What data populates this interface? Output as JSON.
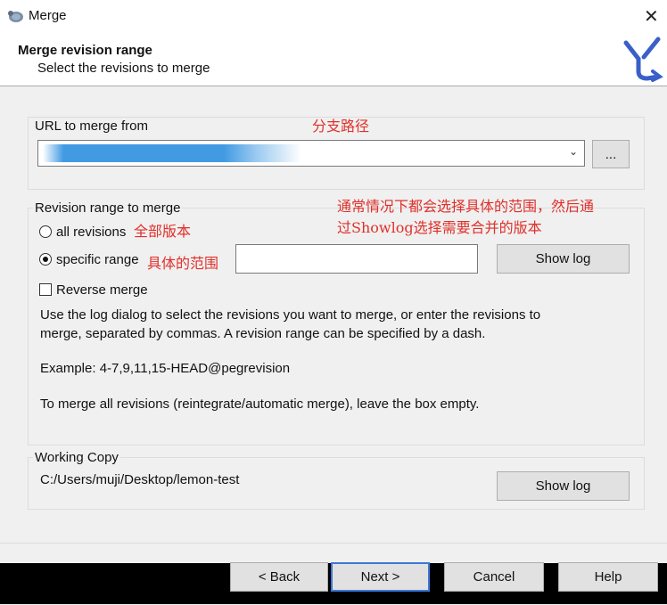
{
  "window": {
    "title": "Merge",
    "close_glyph": "✕"
  },
  "header": {
    "title": "Merge revision range",
    "subtitle": "Select the revisions to merge"
  },
  "url_group": {
    "label": "URL to merge from",
    "browse_label": "...",
    "annotation": "分支路径"
  },
  "revision_group": {
    "label": "Revision range to merge",
    "all_revisions": "all revisions",
    "specific_range": "specific range",
    "annotation_all": "全部版本",
    "annotation_specific": "具体的范围",
    "annotation_hint_line1": "通常情况下都会选择具体的范围，然后通",
    "annotation_hint_line2": "过Showlog选择需要合并的版本",
    "range_value": "",
    "show_log": "Show log",
    "reverse_merge": "Reverse merge",
    "help_text_line1": "Use the log dialog to select the revisions you want to merge, or enter the revisions to",
    "help_text_line2": "merge, separated by commas. A revision range can be specified by a dash.",
    "example": "Example: 4-7,9,11,15-HEAD@pegrevision",
    "reintegrate_note": "To merge all revisions (reintegrate/automatic merge), leave the box empty."
  },
  "working_copy": {
    "label": "Working Copy",
    "path": "C:/Users/muji/Desktop/lemon-test",
    "show_log": "Show log"
  },
  "footer": {
    "back": "< Back",
    "next": "Next >",
    "cancel": "Cancel",
    "help": "Help"
  },
  "colors": {
    "annotation": "#e0302a",
    "accent": "#3c78d8"
  }
}
